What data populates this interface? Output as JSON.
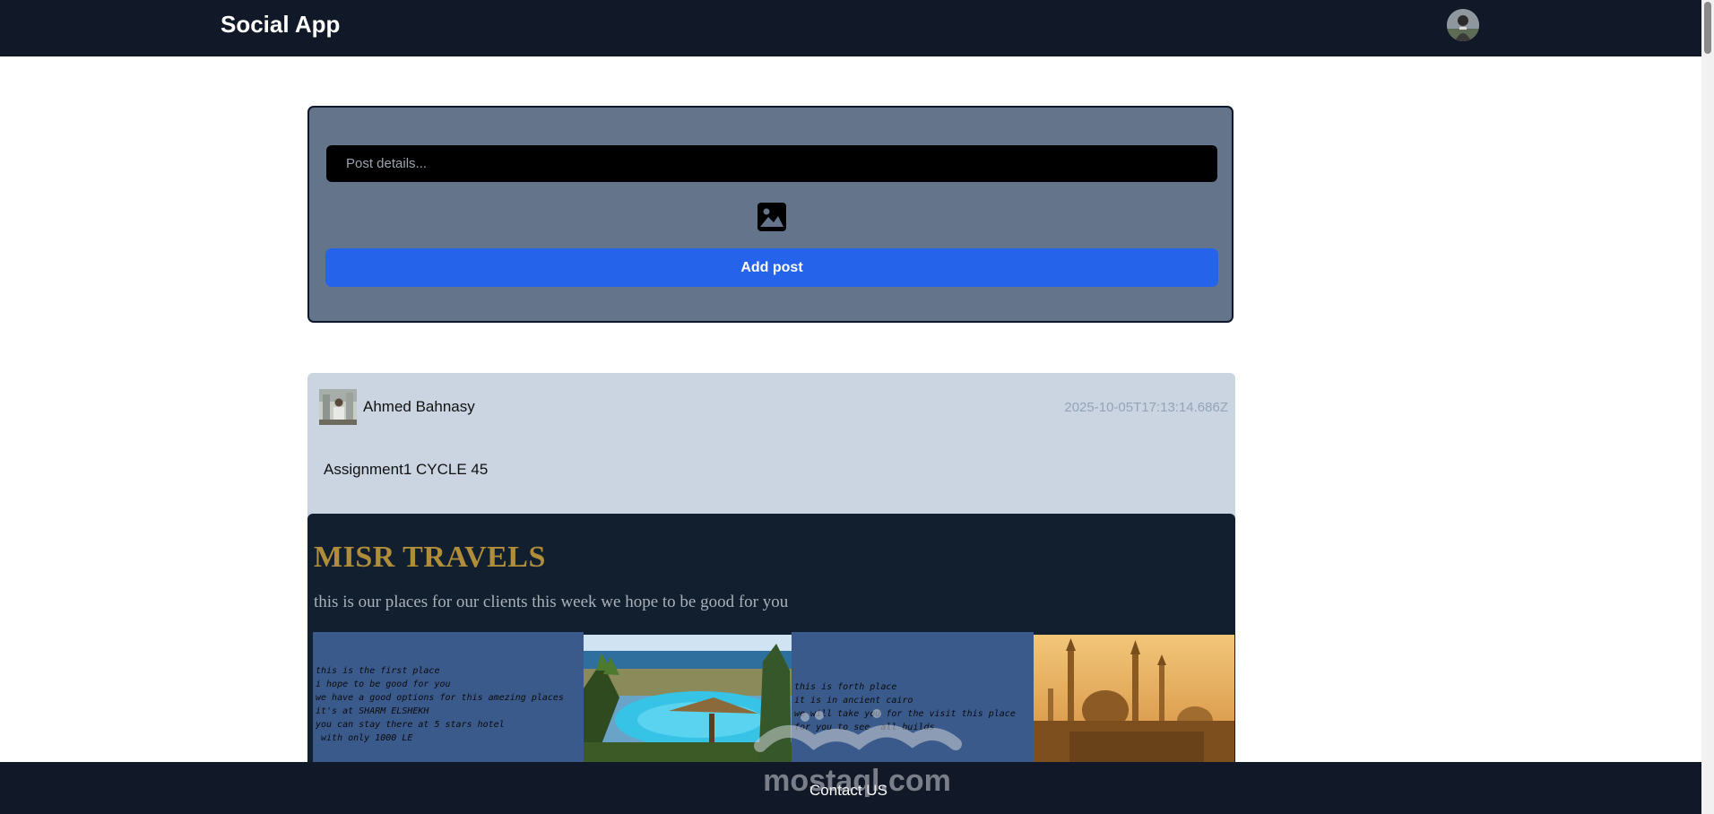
{
  "navbar": {
    "brand": "Social App",
    "avatar_icon": "user-avatar"
  },
  "create_post": {
    "placeholder": "Post details...",
    "image_icon": "image-icon",
    "add_label": "Add post"
  },
  "post": {
    "author": "Ahmed Bahnasy",
    "date": "2025-10-05T17:13:14.686Z",
    "body": "Assignment1 CYCLE 45",
    "image": {
      "title": "MISR TRAVELS",
      "subtitle": "this is our places for our clients this week we hope to be good for you",
      "place1_lines": [
        "this is the first place",
        "i hope to be good for you",
        "we have a good options for this amezing places",
        "it's at SHARM ELSHEKH",
        "you can stay there at 5 stars hotel",
        " with only 1000 LE"
      ],
      "place2_lines": [
        "this is forth place",
        "it is in ancient cairo",
        "we will take you for the visit this place",
        "for you to see  all builds"
      ]
    }
  },
  "footer": {
    "contact": "Contact US"
  },
  "watermark": {
    "text": "mostaql.com"
  },
  "colors": {
    "navbar": "#111827",
    "create_card": "#64748b",
    "button": "#2563eb",
    "post_card": "#cbd5e1",
    "gold": "#b08d3a"
  }
}
